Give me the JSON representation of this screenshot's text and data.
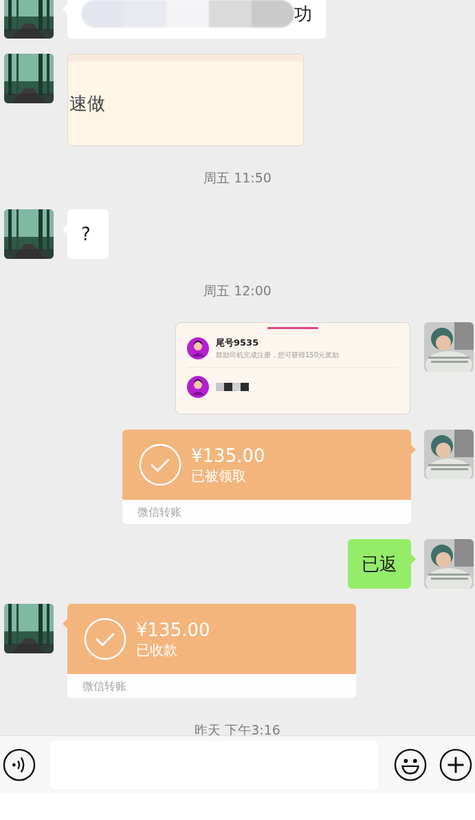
{
  "messages": [
    {
      "kind": "text",
      "outgoing": false,
      "text": "功",
      "redacted": true
    },
    {
      "outgoing": false,
      "text": "速做"
    },
    {
      "kind": "time",
      "text": "周五 11:50"
    },
    {
      "kind": "text",
      "outgoing": false,
      "text": "?",
      "redacted": false
    },
    {
      "kind": "time",
      "text": "周五 12:00"
    },
    {
      "kind": "card",
      "outgoing": true,
      "rows": [
        {
          "title": "尾号9535",
          "subtitle": "鼓励司机完成注册，您可获得150元奖励",
          "redacted": false
        },
        {
          "redacted": true
        }
      ]
    },
    {
      "kind": "transfer",
      "outgoing": true,
      "amount": "¥135.00",
      "status": "已被领取",
      "footer": "微信转账"
    },
    {
      "kind": "text",
      "outgoing": true,
      "text": "已返",
      "redacted": false
    },
    {
      "kind": "transfer",
      "outgoing": false,
      "amount": "¥135.00",
      "status": "已收款",
      "footer": "微信转账"
    },
    {
      "kind": "time",
      "text": "昨天 下午3:16"
    }
  ]
}
